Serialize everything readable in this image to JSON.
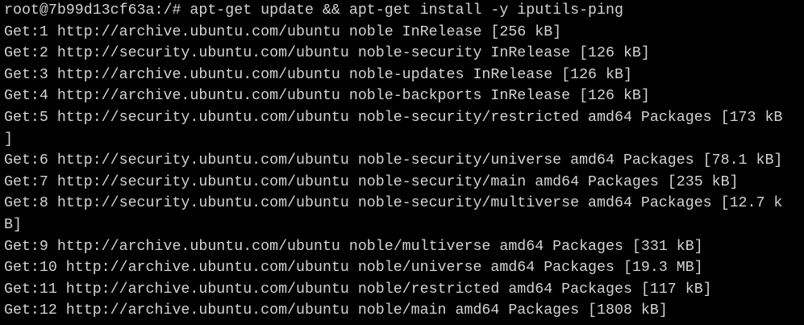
{
  "terminal": {
    "colors": {
      "background": "#000000",
      "foreground": "#d3d3d3"
    },
    "lines": [
      "root@7b99d13cf63a:/# apt-get update && apt-get install -y iputils-ping",
      "Get:1 http://archive.ubuntu.com/ubuntu noble InRelease [256 kB]",
      "Get:2 http://security.ubuntu.com/ubuntu noble-security InRelease [126 kB]",
      "Get:3 http://archive.ubuntu.com/ubuntu noble-updates InRelease [126 kB]",
      "Get:4 http://archive.ubuntu.com/ubuntu noble-backports InRelease [126 kB]",
      "Get:5 http://security.ubuntu.com/ubuntu noble-security/restricted amd64 Packages [173 kB",
      "]",
      "Get:6 http://security.ubuntu.com/ubuntu noble-security/universe amd64 Packages [78.1 kB]",
      "Get:7 http://security.ubuntu.com/ubuntu noble-security/main amd64 Packages [235 kB]",
      "Get:8 http://security.ubuntu.com/ubuntu noble-security/multiverse amd64 Packages [12.7 k",
      "B]",
      "Get:9 http://archive.ubuntu.com/ubuntu noble/multiverse amd64 Packages [331 kB]",
      "Get:10 http://archive.ubuntu.com/ubuntu noble/universe amd64 Packages [19.3 MB]",
      "Get:11 http://archive.ubuntu.com/ubuntu noble/restricted amd64 Packages [117 kB]",
      "Get:12 http://archive.ubuntu.com/ubuntu noble/main amd64 Packages [1808 kB]"
    ]
  }
}
